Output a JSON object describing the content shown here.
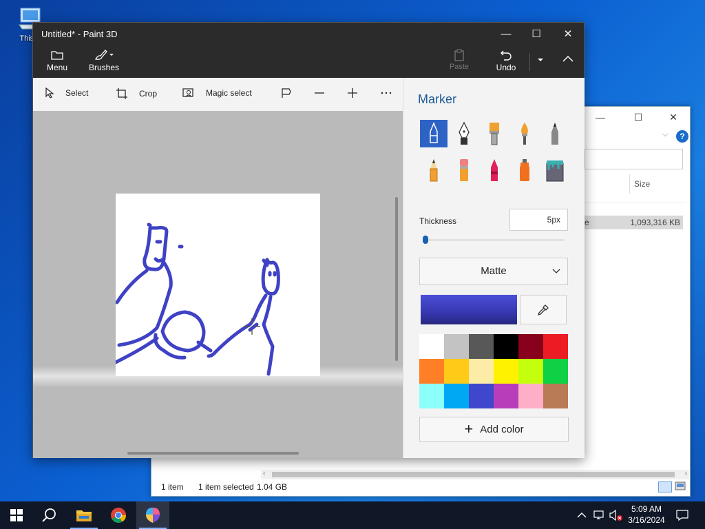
{
  "desktop": {
    "icon_label": "This P"
  },
  "explorer": {
    "column_size": "Size",
    "file_row_name_fragment": "e",
    "file_row_size": "1,093,316 KB",
    "status_count": "1 item",
    "status_selected": "1 item selected",
    "status_size": "1.04 GB"
  },
  "paint": {
    "title": "Untitled* - Paint 3D",
    "ribbon": {
      "menu": "Menu",
      "brushes": "Brushes",
      "paste": "Paste",
      "undo": "Undo"
    },
    "toolbar": {
      "select": "Select",
      "crop": "Crop",
      "magic_select": "Magic select"
    },
    "panel": {
      "title": "Marker",
      "thickness_label": "Thickness",
      "thickness_value": "5px",
      "thickness_level_px": 5,
      "finish_value": "Matte",
      "add_color": "Add color",
      "tools": [
        "marker-icon",
        "calligraphy-pen-icon",
        "oil-brush-icon",
        "watercolor-icon",
        "pencil-icon",
        "graphite-pencil-icon",
        "eraser-icon",
        "crayon-icon",
        "spray-can-icon",
        "fill-bucket-icon"
      ],
      "selected_tool": "marker-icon",
      "current_color": "#3f42c4",
      "palette": [
        "#ffffff",
        "#c3c3c3",
        "#585858",
        "#000000",
        "#88001b",
        "#ec1c24",
        "#ff7f27",
        "#ffca18",
        "#fdeca6",
        "#fff200",
        "#c4ff0e",
        "#0ed145",
        "#8cfffb",
        "#00a8f3",
        "#3f48cc",
        "#b83dba",
        "#ffaec8",
        "#b97a56"
      ]
    },
    "stroke_color": "#3f42c4"
  },
  "taskbar": {
    "time": "5:09 AM",
    "date": "3/16/2024"
  }
}
